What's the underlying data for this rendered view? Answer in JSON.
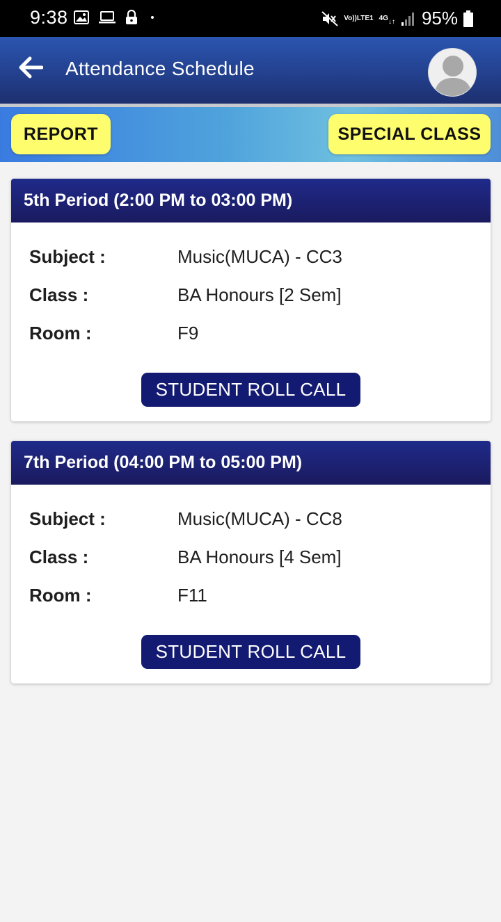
{
  "status_bar": {
    "time": "9:38",
    "left_icons": [
      "image-icon",
      "laptop-icon",
      "lock-icon",
      "dot-icon"
    ],
    "volte_top": "Vo))",
    "volte_bottom": "LTE1",
    "network": "4G",
    "battery_percent": "95%"
  },
  "app_bar": {
    "title": "Attendance Schedule",
    "back_icon": "arrow-left-icon",
    "avatar_icon": "user-avatar-icon"
  },
  "actions": {
    "report_label": "REPORT",
    "special_class_label": "SPECIAL CLASS"
  },
  "labels": {
    "subject": "Subject :",
    "class": "Class :",
    "room": "Room :",
    "roll_call": "STUDENT ROLL CALL"
  },
  "periods": [
    {
      "header": "5th Period (2:00 PM to 03:00 PM)",
      "subject": "Music(MUCA) - CC3",
      "class": "BA Honours [2 Sem]",
      "room": "F9"
    },
    {
      "header": "7th Period (04:00 PM to 05:00 PM)",
      "subject": "Music(MUCA) - CC8",
      "class": "BA Honours [4 Sem]",
      "room": "F11"
    }
  ],
  "colors": {
    "app_bar": "#23418e",
    "action_button": "#fdfd6e",
    "card_header": "#1a1a5e",
    "roll_call_button": "#131a72",
    "background": "#f3f3f4"
  }
}
